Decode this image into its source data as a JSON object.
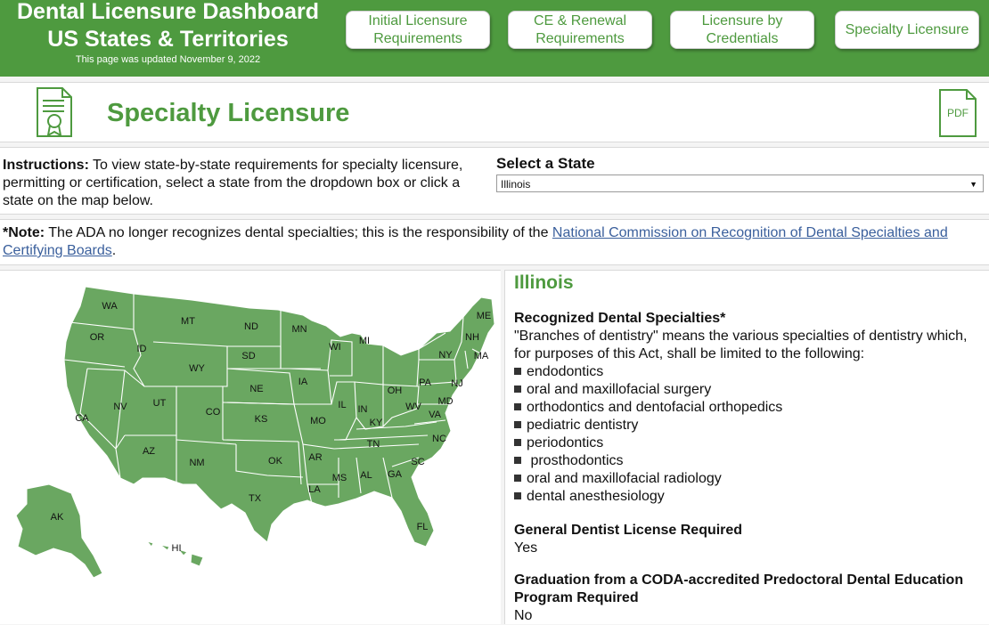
{
  "header": {
    "title_line1": "Dental Licensure Dashboard",
    "title_line2": "US States & Territories",
    "updated": "This page was updated November 9, 2022",
    "background_color": "#4e9a3f",
    "nav": [
      "Initial Licensure Requirements",
      "CE & Renewal Requirements",
      "Licensure by Credentials",
      "Specialty Licensure"
    ]
  },
  "page": {
    "title": "Specialty Licensure",
    "left_icon": "certificate-icon",
    "pdf_label": "PDF"
  },
  "instructions": {
    "label": "Instructions:",
    "text": " To view state-by-state requirements for specialty licensure, permitting or certification, select a state from the dropdown box or click a state on the map below."
  },
  "state_select": {
    "label": "Select a State",
    "value": "Illinois"
  },
  "note": {
    "label": "*Note:",
    "text": " The ADA no longer recognizes dental specialties; this is the responsibility of the ",
    "link": "National Commission on Recognition of Dental Specialties and Certifying Boards",
    "end": "."
  },
  "map": {
    "fill_color": "#6aa761",
    "labels": [
      "WA",
      "OR",
      "CA",
      "ID",
      "NV",
      "MT",
      "WY",
      "UT",
      "AZ",
      "CO",
      "NM",
      "ND",
      "SD",
      "NE",
      "KS",
      "OK",
      "TX",
      "MN",
      "IA",
      "MO",
      "AR",
      "LA",
      "WI",
      "IL",
      "MI",
      "IN",
      "KY",
      "TN",
      "MS",
      "AL",
      "GA",
      "FL",
      "OH",
      "WV",
      "VA",
      "NC",
      "SC",
      "PA",
      "NY",
      "MD",
      "NJ",
      "ME",
      "NH",
      "MA",
      "AK",
      "HI"
    ]
  },
  "detail": {
    "state": "Illinois",
    "specialties_heading": "Recognized Dental Specialties*",
    "specialties_intro": "\"Branches of dentistry\" means the various specialties of dentistry which, for purposes of this Act, shall be limited to the following:",
    "specialties": [
      "endodontics",
      "oral and maxillofacial surgery",
      "orthodontics and dentofacial orthopedics",
      "pediatric dentistry",
      "periodontics",
      " prosthodontics",
      "oral and maxillofacial radiology",
      "dental anesthesiology"
    ],
    "gd_heading": "General Dentist License Required",
    "gd_value": "Yes",
    "coda_heading": "Graduation from a CODA-accredited Predoctoral Dental Education Program Required",
    "coda_value": "No"
  }
}
